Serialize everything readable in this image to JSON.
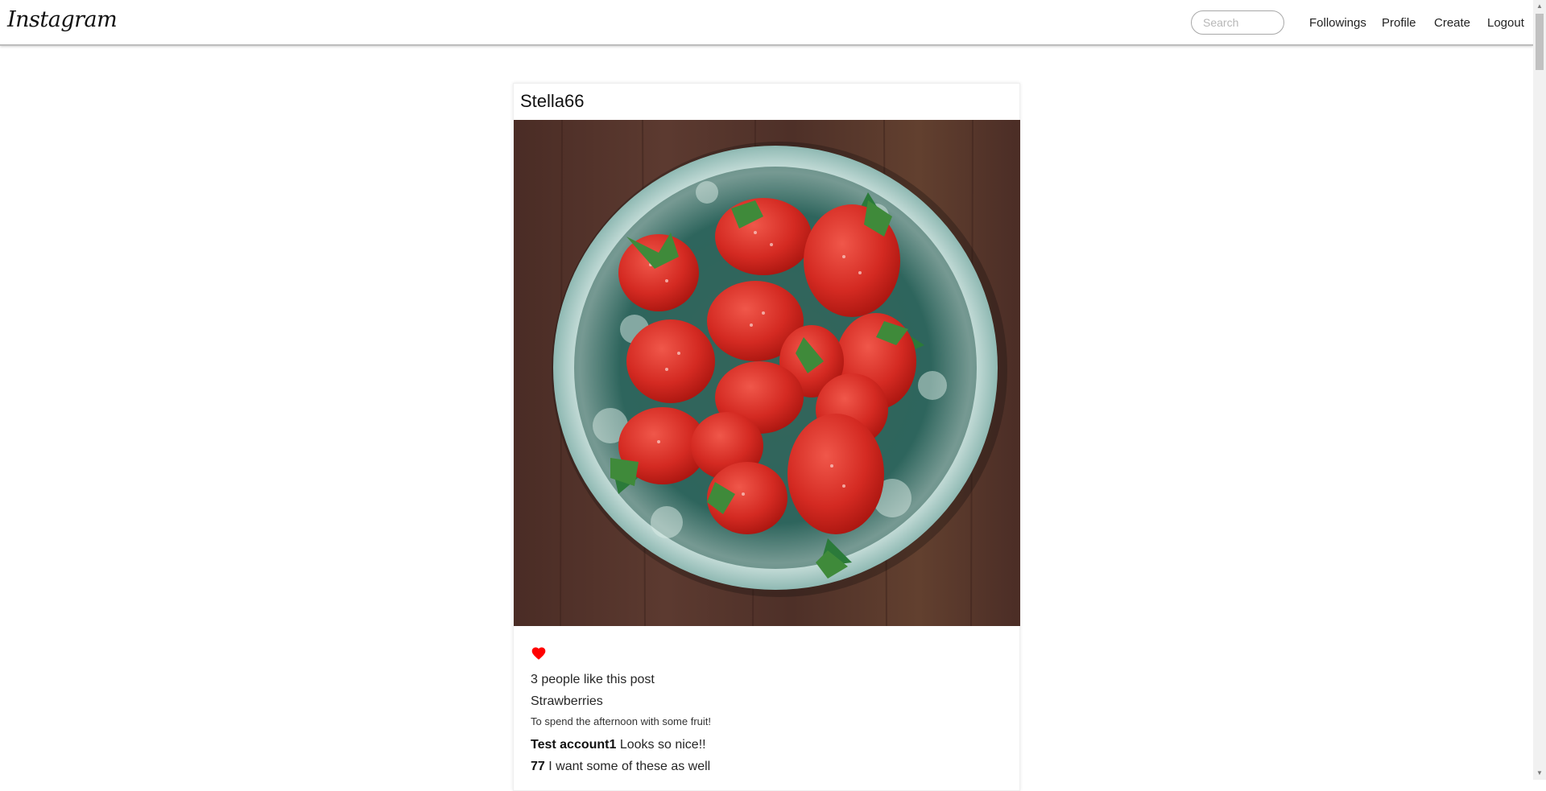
{
  "navbar": {
    "logo": "Instagram",
    "search_placeholder": "Search",
    "search_value": "",
    "links": [
      "Followings",
      "Profile",
      "Create",
      "Logout"
    ]
  },
  "post": {
    "username": "Stella66",
    "image_alt": "Bowl of strawberries",
    "liked": true,
    "likes_text": "3 people like this post",
    "title": "Strawberries",
    "description": "To spend the afternoon with some fruit!",
    "comments": [
      {
        "author": "Test account1",
        "text": "Looks so nice!!"
      },
      {
        "author": "77",
        "text": "I want some of these as well"
      }
    ]
  },
  "colors": {
    "heart": "#ff0000",
    "nav_border": "#bdbdbd",
    "search_border": "#a8a8a8",
    "text": "#262626"
  },
  "icons": [
    "heart-icon",
    "scroll-up-icon",
    "scroll-down-icon"
  ]
}
